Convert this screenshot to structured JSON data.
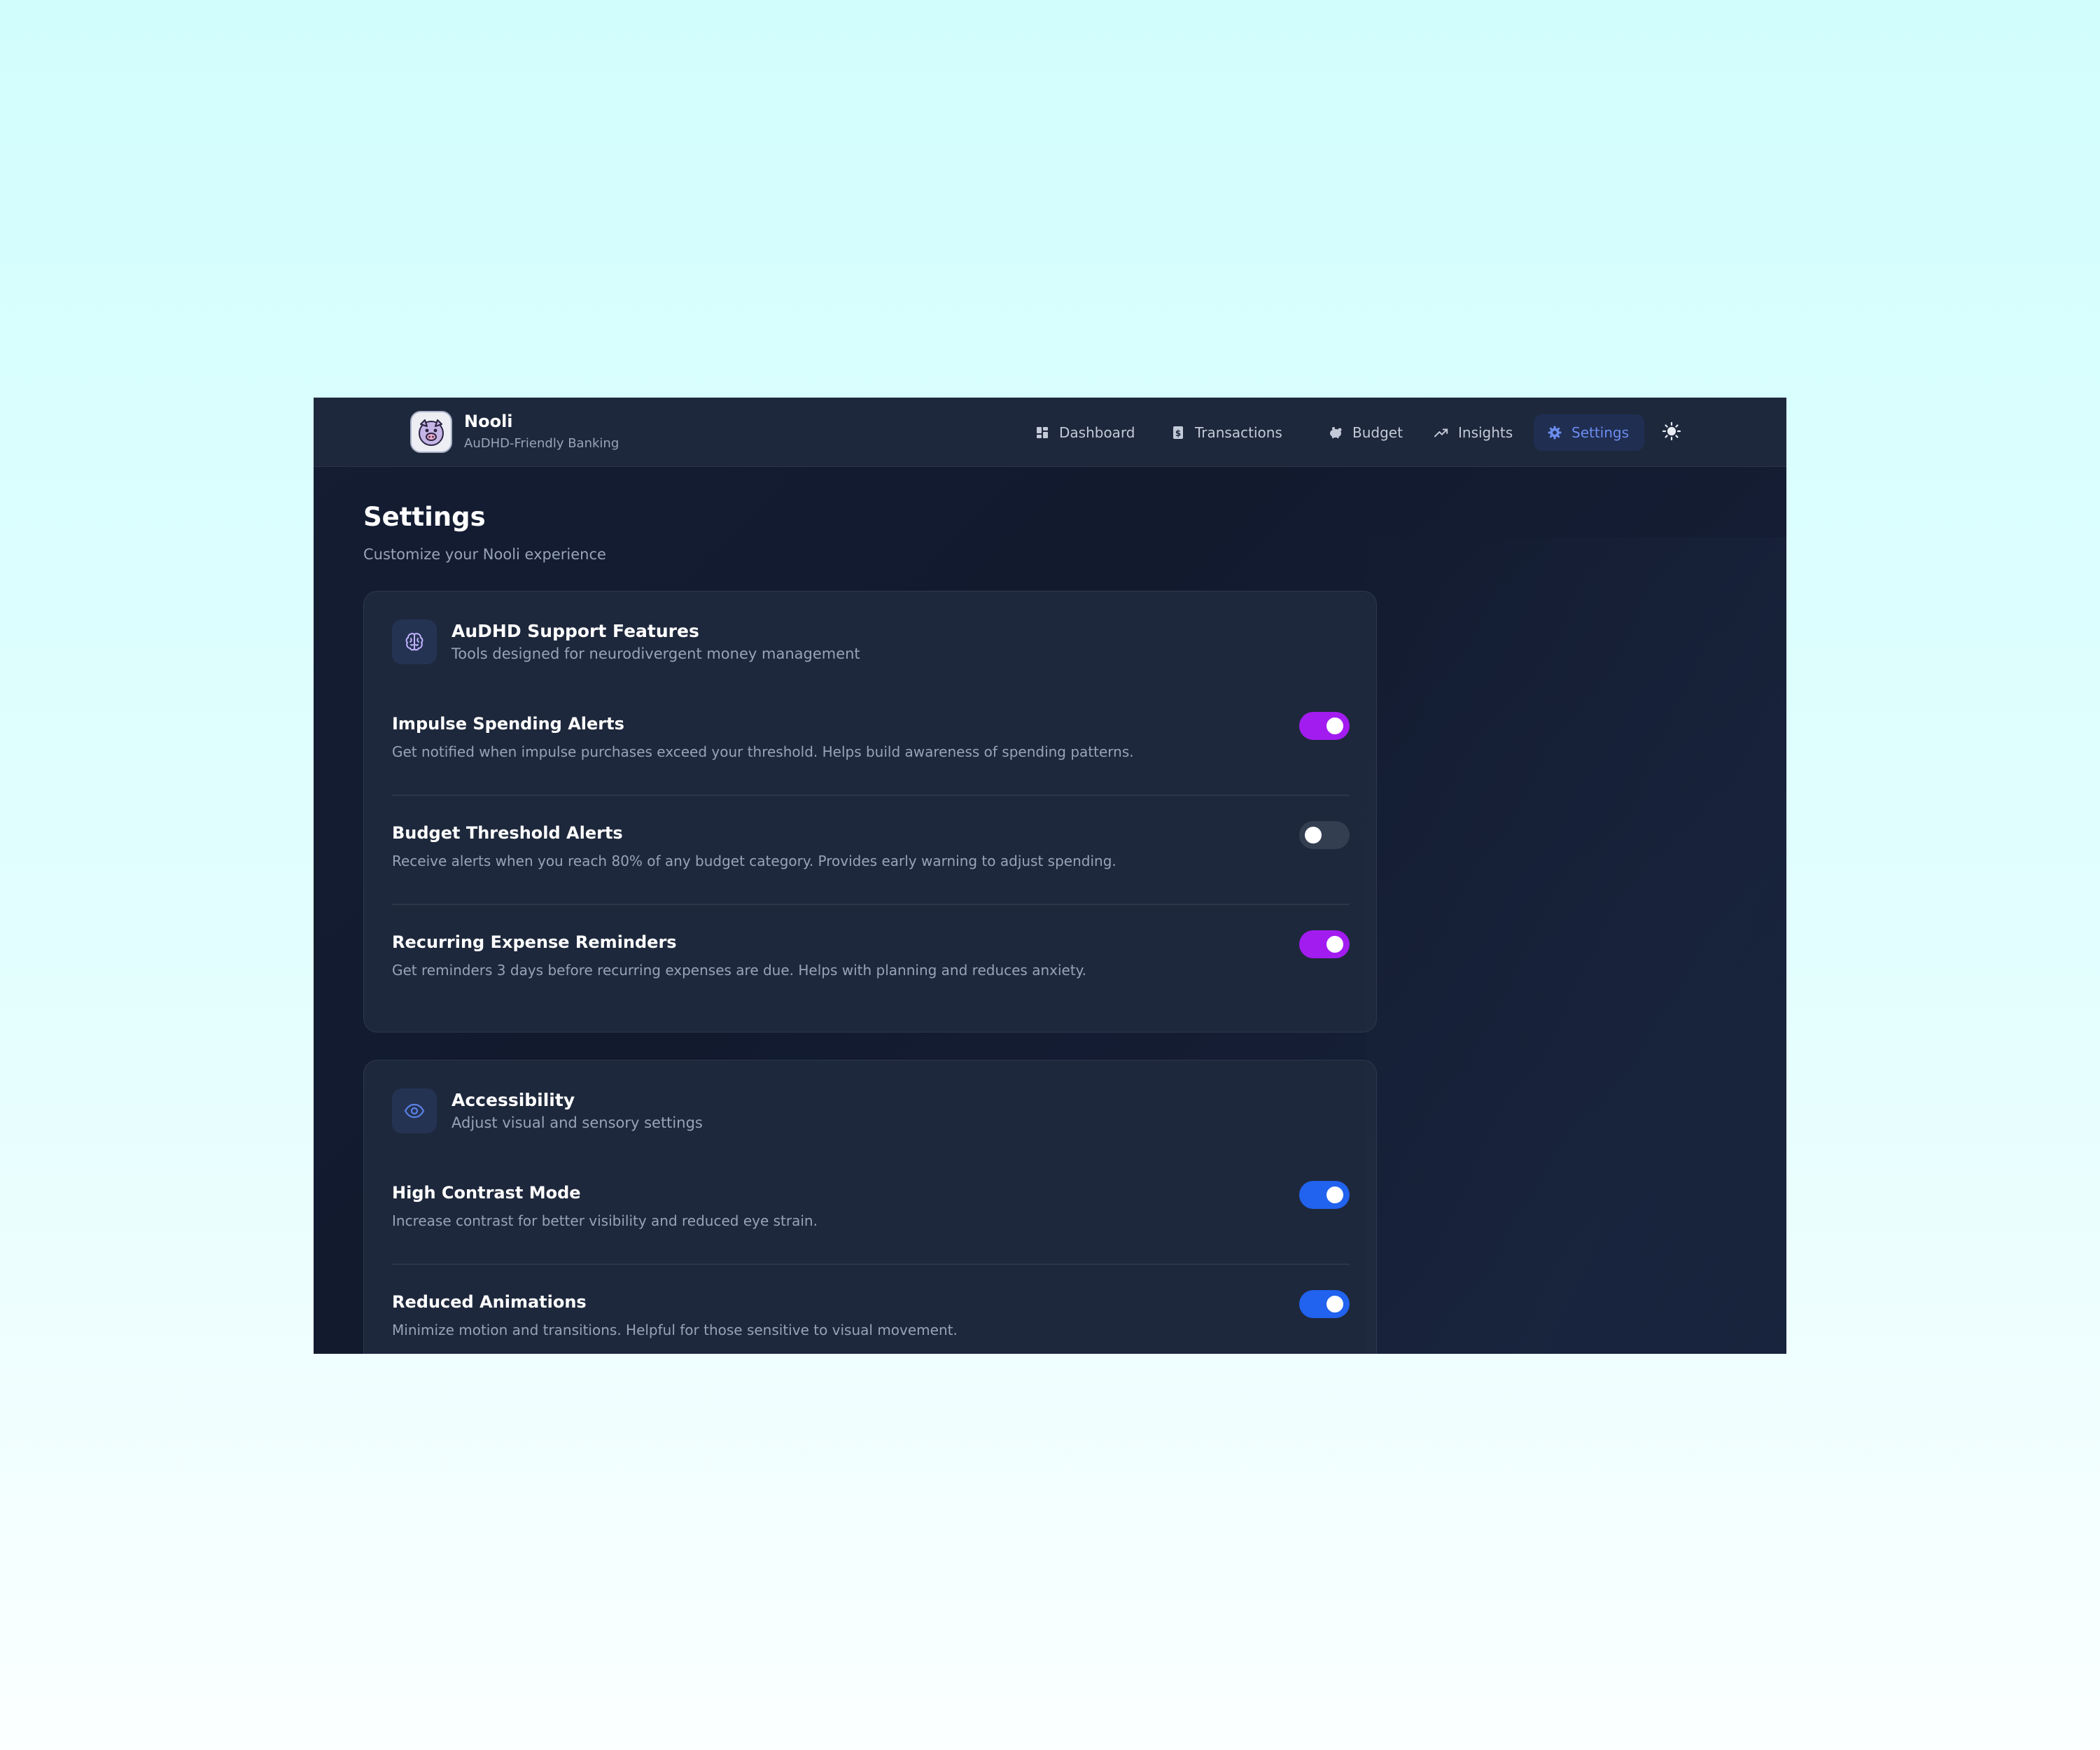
{
  "brand": {
    "name": "Nooli",
    "tagline": "AuDHD-Friendly Banking",
    "logo_icon": "pig-face-icon"
  },
  "nav": {
    "items": [
      {
        "label": "Dashboard",
        "icon": "dashboard-grid-icon"
      },
      {
        "label": "Transactions",
        "icon": "receipt-dollar-icon"
      },
      {
        "label": "Budget",
        "icon": "piggy-bank-icon"
      },
      {
        "label": "Insights",
        "icon": "trending-up-icon"
      },
      {
        "label": "Settings",
        "icon": "gear-icon",
        "active": true
      }
    ],
    "theme_toggle_icon": "sun-icon"
  },
  "page": {
    "title": "Settings",
    "subtitle": "Customize your Nooli experience"
  },
  "sections": [
    {
      "title": "AuDHD Support Features",
      "subtitle": "Tools designed for neurodivergent money management",
      "icon": "brain-icon",
      "accent": "#a21cf0",
      "settings": [
        {
          "name": "Impulse Spending Alerts",
          "description": "Get notified when impulse purchases exceed your threshold. Helps build awareness of spending patterns.",
          "enabled": true
        },
        {
          "name": "Budget Threshold Alerts",
          "description": "Receive alerts when you reach 80% of any budget category. Provides early warning to adjust spending.",
          "enabled": false
        },
        {
          "name": "Recurring Expense Reminders",
          "description": "Get reminders 3 days before recurring expenses are due. Helps with planning and reduces anxiety.",
          "enabled": true
        }
      ]
    },
    {
      "title": "Accessibility",
      "subtitle": "Adjust visual and sensory settings",
      "icon": "eye-icon",
      "accent": "#2162ee",
      "settings": [
        {
          "name": "High Contrast Mode",
          "description": "Increase contrast for better visibility and reduced eye strain.",
          "enabled": true
        },
        {
          "name": "Reduced Animations",
          "description": "Minimize motion and transitions. Helpful for those sensitive to visual movement.",
          "enabled": true
        }
      ]
    }
  ],
  "colors": {
    "toggle_off": "#343e51",
    "nav_active_bg": "#202e52",
    "nav_active_text": "#6b8dee"
  }
}
